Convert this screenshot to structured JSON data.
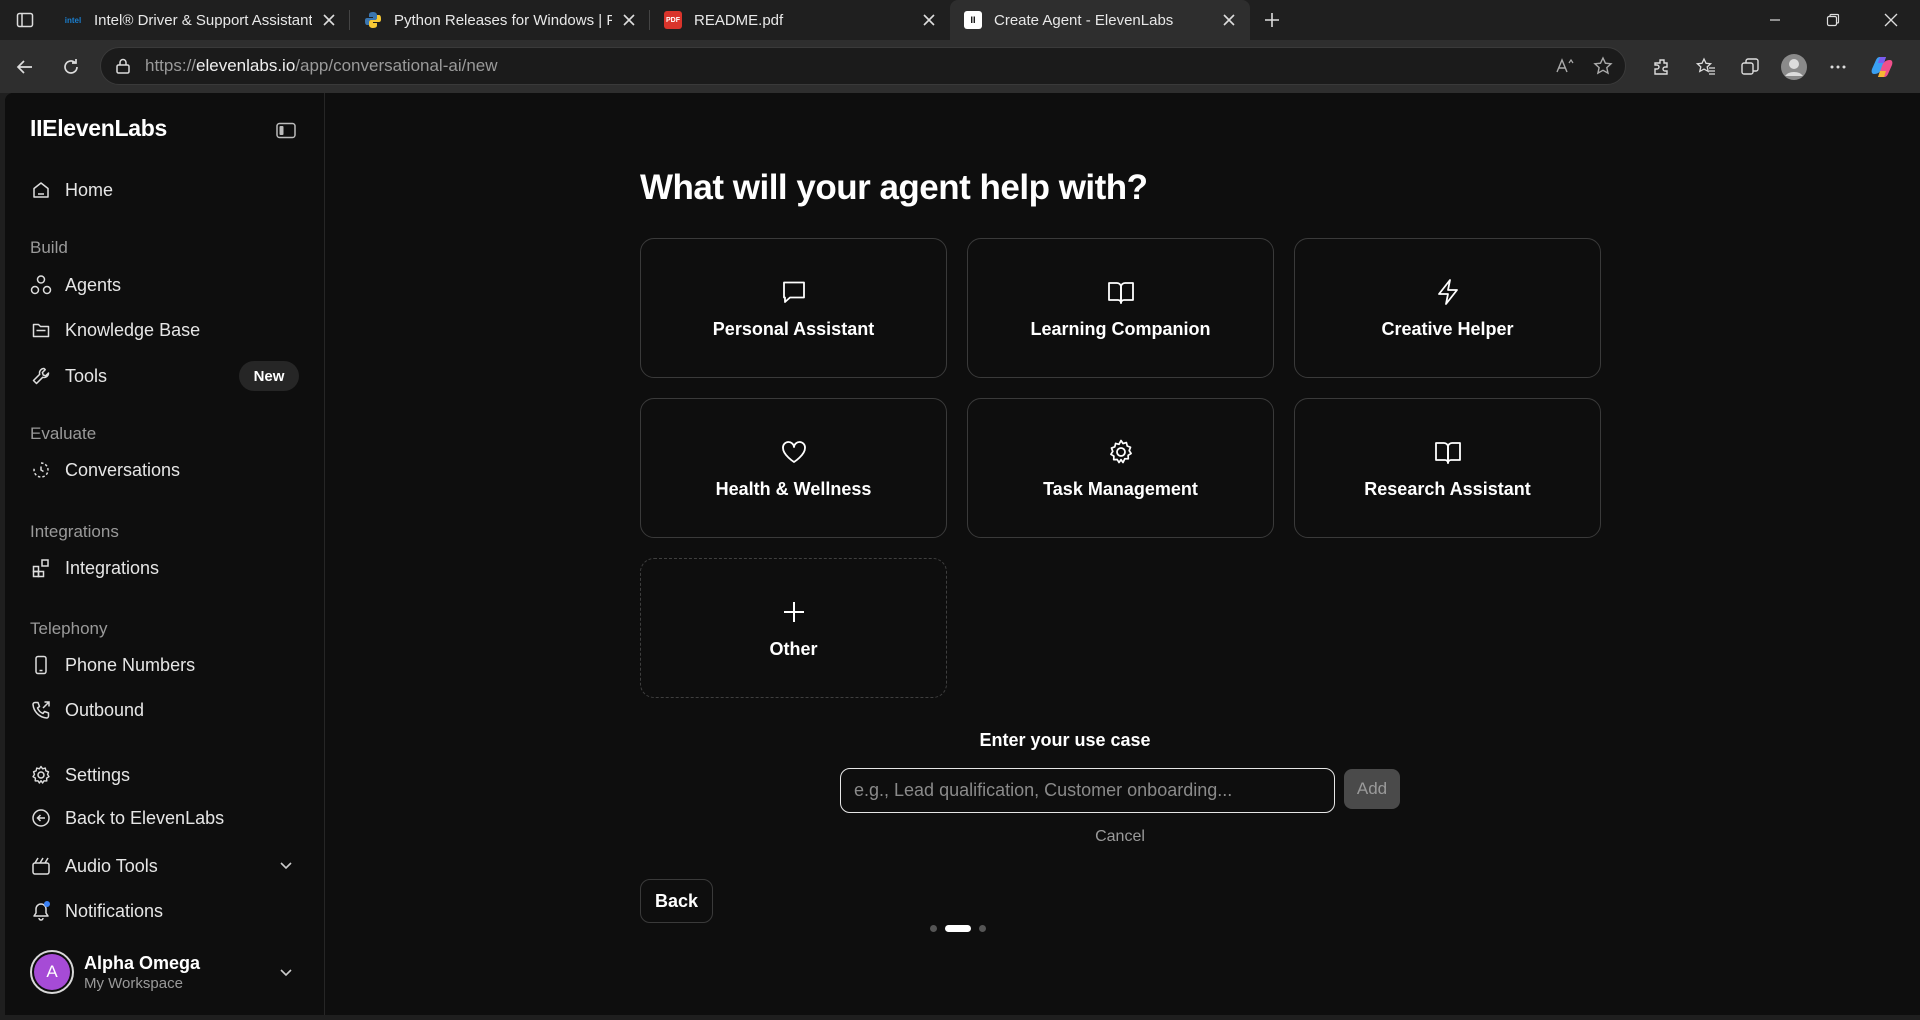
{
  "browser": {
    "tabs": [
      {
        "title": "Intel® Driver & Support Assistant",
        "favicon": "intel-icon",
        "favicon_text": "intel"
      },
      {
        "title": "Python Releases for Windows | Py",
        "favicon": "python-icon"
      },
      {
        "title": "README.pdf",
        "favicon": "pdf-icon",
        "favicon_text": "PDF"
      },
      {
        "title": "Create Agent - ElevenLabs",
        "favicon": "elevenlabs-icon",
        "favicon_text": "II",
        "active": true
      }
    ],
    "url": {
      "scheme": "https://",
      "host": "elevenlabs.io",
      "path": "/app/conversational-ai/new"
    }
  },
  "sidebar": {
    "logo": "IIElevenLabs",
    "home": "Home",
    "sections": {
      "build": "Build",
      "evaluate": "Evaluate",
      "integrations": "Integrations",
      "telephony": "Telephony"
    },
    "items": {
      "agents": "Agents",
      "knowledge_base": "Knowledge Base",
      "tools": "Tools",
      "tools_badge": "New",
      "conversations": "Conversations",
      "integrations": "Integrations",
      "phone_numbers": "Phone Numbers",
      "outbound": "Outbound",
      "settings": "Settings",
      "back": "Back to ElevenLabs",
      "audio_tools": "Audio Tools",
      "notifications": "Notifications"
    },
    "user": {
      "initial": "A",
      "name": "Alpha Omega",
      "workspace": "My Workspace"
    }
  },
  "main": {
    "title": "What will your agent help with?",
    "options": [
      {
        "label": "Personal Assistant",
        "icon": "chat-bubble-icon"
      },
      {
        "label": "Learning Companion",
        "icon": "book-open-icon"
      },
      {
        "label": "Creative Helper",
        "icon": "lightning-icon"
      },
      {
        "label": "Health & Wellness",
        "icon": "heart-icon"
      },
      {
        "label": "Task Management",
        "icon": "gear-icon"
      },
      {
        "label": "Research Assistant",
        "icon": "book-open-icon"
      },
      {
        "label": "Other",
        "icon": "plus-icon"
      }
    ],
    "usecase": {
      "label": "Enter your use case",
      "placeholder": "e.g., Lead qualification, Customer onboarding...",
      "value": "",
      "add": "Add",
      "cancel": "Cancel"
    },
    "back": "Back",
    "steps": {
      "total": 3,
      "current": 2
    }
  },
  "colors": {
    "background": "#0e0e0e",
    "chrome": "#1f1f1f",
    "card_border": "#3a3a3a",
    "avatar": "#a64bd6",
    "notification_dot": "#3b82f6"
  }
}
